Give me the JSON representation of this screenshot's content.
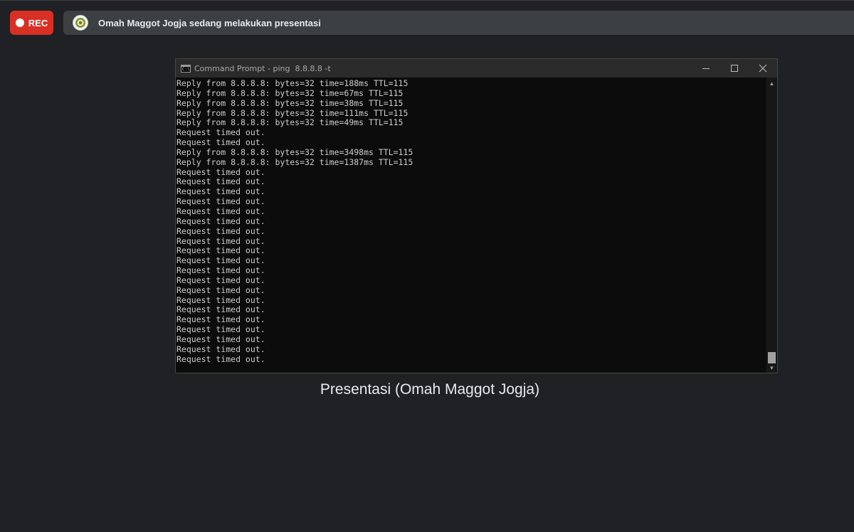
{
  "recording": {
    "label": "REC"
  },
  "presenting_bar": {
    "text": "Omah Maggot Jogja sedang melakukan presentasi"
  },
  "cmd_window": {
    "title": "Command Prompt - ping  8.8.8.8 -t",
    "icon_text": "C:\\",
    "lines": [
      "Reply from 8.8.8.8: bytes=32 time=188ms TTL=115",
      "Reply from 8.8.8.8: bytes=32 time=67ms TTL=115",
      "Reply from 8.8.8.8: bytes=32 time=38ms TTL=115",
      "Reply from 8.8.8.8: bytes=32 time=111ms TTL=115",
      "Reply from 8.8.8.8: bytes=32 time=49ms TTL=115",
      "Request timed out.",
      "Request timed out.",
      "Reply from 8.8.8.8: bytes=32 time=3498ms TTL=115",
      "Reply from 8.8.8.8: bytes=32 time=1387ms TTL=115",
      "Request timed out.",
      "Request timed out.",
      "Request timed out.",
      "Request timed out.",
      "Request timed out.",
      "Request timed out.",
      "Request timed out.",
      "Request timed out.",
      "Request timed out.",
      "Request timed out.",
      "Request timed out.",
      "Request timed out.",
      "Request timed out.",
      "Request timed out.",
      "Request timed out.",
      "Request timed out.",
      "Request timed out.",
      "Request timed out.",
      "Request timed out.",
      "Request timed out."
    ]
  },
  "caption": "Presentasi (Omah Maggot Jogja)",
  "colors": {
    "background": "#202124",
    "rec_red": "#d93025",
    "bar": "#3c4043",
    "console_bg": "#0c0c0c",
    "console_text": "#cccccc"
  }
}
